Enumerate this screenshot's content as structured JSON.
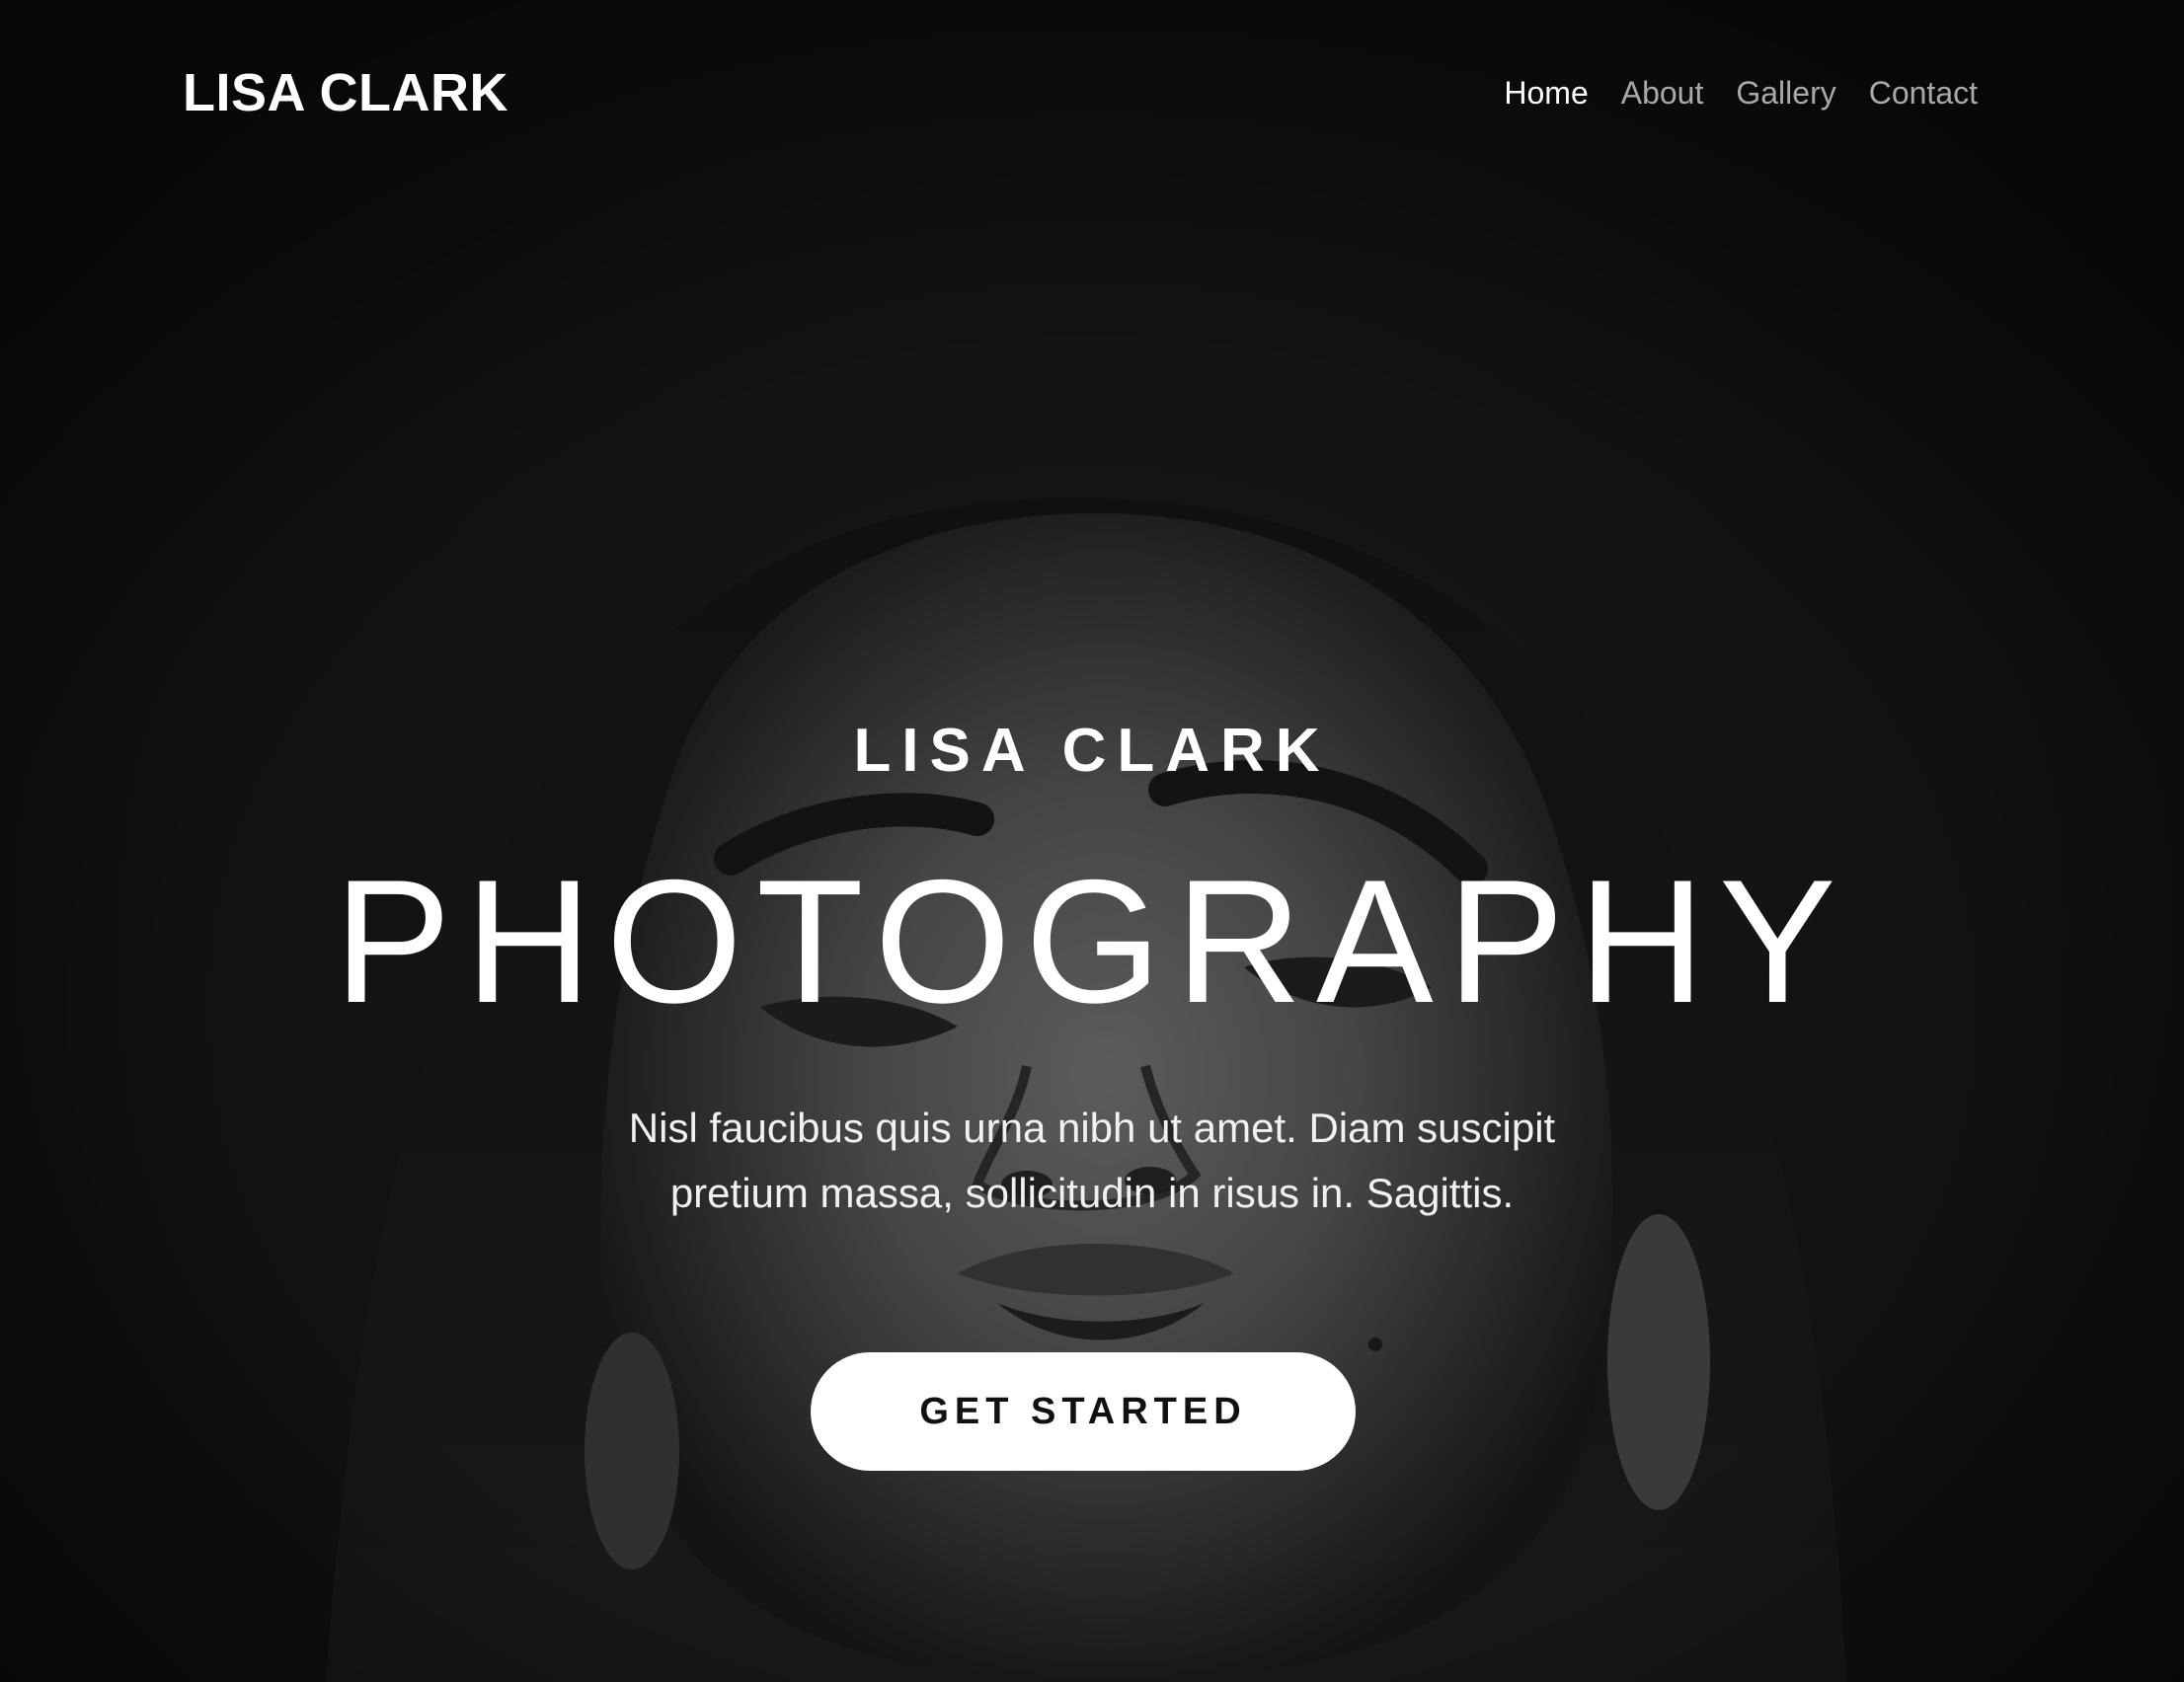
{
  "site": {
    "logo": "LISA CLARK"
  },
  "nav": {
    "items": [
      {
        "label": "Home",
        "active": true
      },
      {
        "label": "About",
        "active": false
      },
      {
        "label": "Gallery",
        "active": false
      },
      {
        "label": "Contact",
        "active": false
      }
    ]
  },
  "hero": {
    "kicker": "LISA CLARK",
    "title": "PHOTOGRAPHY",
    "description_lines": [
      "Nisl faucibus quis urna nibh ut amet. Diam suscipit",
      "pretium massa, sollicitudin in risus in. Sagittis."
    ],
    "cta_label": "GET STARTED"
  },
  "colors": {
    "background": "#1c1c1c",
    "text": "#ffffff",
    "nav_inactive": "#a9a9a9",
    "button_bg": "#ffffff",
    "button_text": "#111111"
  },
  "background_image": "black-and-white-portrait-of-woman-face"
}
